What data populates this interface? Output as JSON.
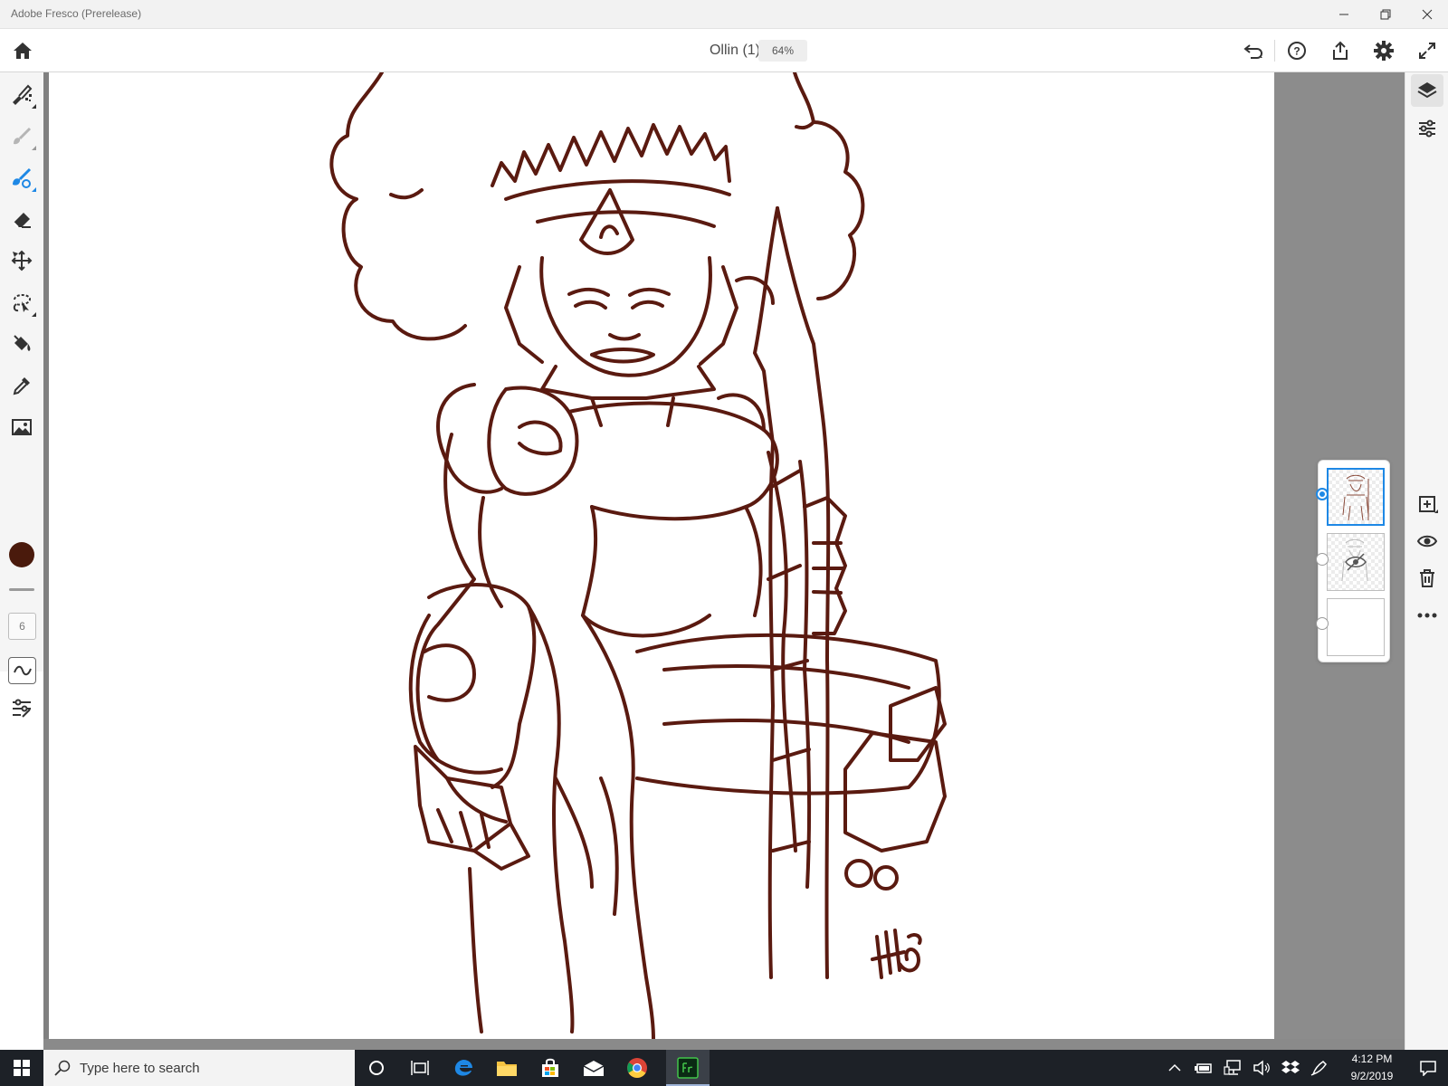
{
  "window": {
    "title": "Adobe Fresco (Prerelease)",
    "controls": [
      "minimize",
      "restore",
      "close"
    ]
  },
  "header": {
    "doc_title": "Ollin (1)",
    "zoom": "64%",
    "buttons": [
      "home",
      "undo",
      "help",
      "share",
      "settings",
      "fullscreen"
    ]
  },
  "toolbar": {
    "tools": [
      "pixel-brush",
      "live-brush",
      "vector-brush",
      "eraser",
      "move-transform",
      "lasso-select",
      "fill",
      "eyedropper",
      "place-image"
    ],
    "active_tool": "vector-brush",
    "color": "#4a1a0c",
    "brush_size": "6"
  },
  "layers": {
    "count": 3,
    "selected_index": 0,
    "items": [
      {
        "name": "layer-1",
        "visible": true,
        "selected": true
      },
      {
        "name": "layer-2",
        "visible": false,
        "selected": false
      },
      {
        "name": "layer-3",
        "visible": true,
        "selected": false
      }
    ]
  },
  "right_rail": [
    "layers",
    "layer-properties",
    "add-layer",
    "visibility",
    "delete-layer",
    "more"
  ],
  "taskbar": {
    "search_placeholder": "Type here to search",
    "time": "4:12 PM",
    "date": "9/2/2019"
  },
  "colors": {
    "accent": "#1e88e5",
    "ink": "#5a1a10",
    "taskbar": "#1d2127"
  }
}
